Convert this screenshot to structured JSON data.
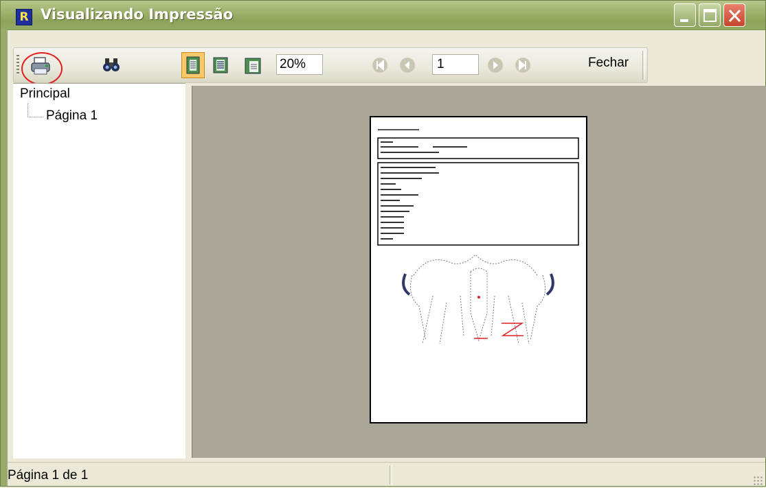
{
  "window": {
    "title": "Visualizando Impressão",
    "icon_letter": "R"
  },
  "toolbar": {
    "zoom_value": "20%",
    "page_number": "1",
    "close_label": "Fechar"
  },
  "tree": {
    "root": "Principal",
    "child": "Página 1"
  },
  "status": {
    "text": "Página 1 de 1"
  },
  "colors": {
    "titlebar": "#a2b571",
    "preview_bg": "#a9a597",
    "highlight": "#e31b1b"
  }
}
